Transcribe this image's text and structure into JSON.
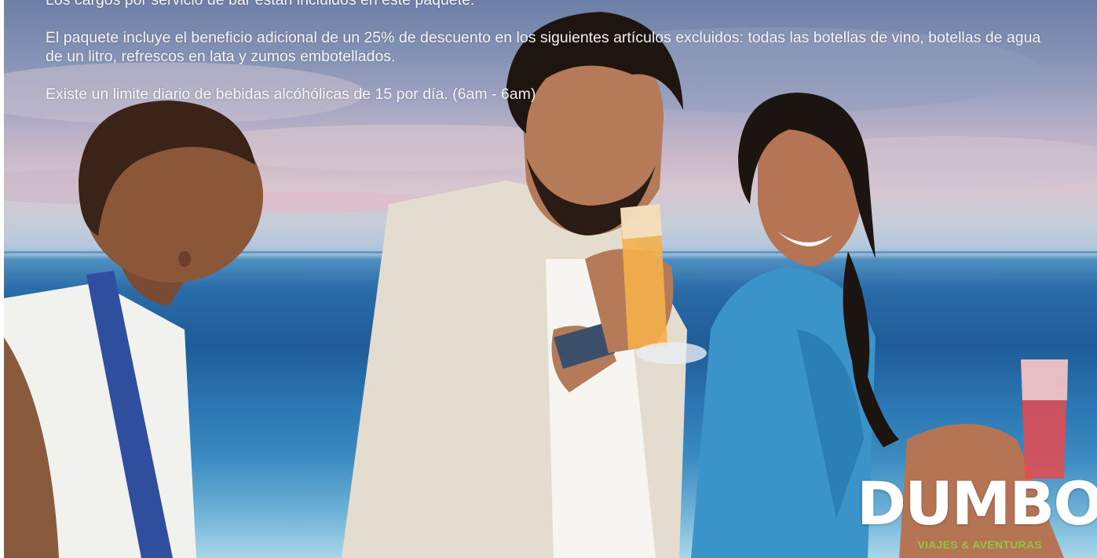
{
  "package_info": {
    "paragraphs": [
      "Los cargos por servicio de bar están incluidos en este paquete.",
      "El paquete incluye el beneficio adicional de un 25% de descuento en los siguientes artículos excluidos: todas las botellas de vino, botellas de agua de un litro, refrescos en lata y zumos embotellados.",
      "Existe un limite diario de bebidas alcóhólicas de 15 por día. (6am - 6am)"
    ]
  },
  "logo": {
    "name": "DUMBO",
    "tagline": "VIAJES & AVENTURAS"
  },
  "colors": {
    "logo_accent": "#8dc63f",
    "text": "#ffffff"
  }
}
